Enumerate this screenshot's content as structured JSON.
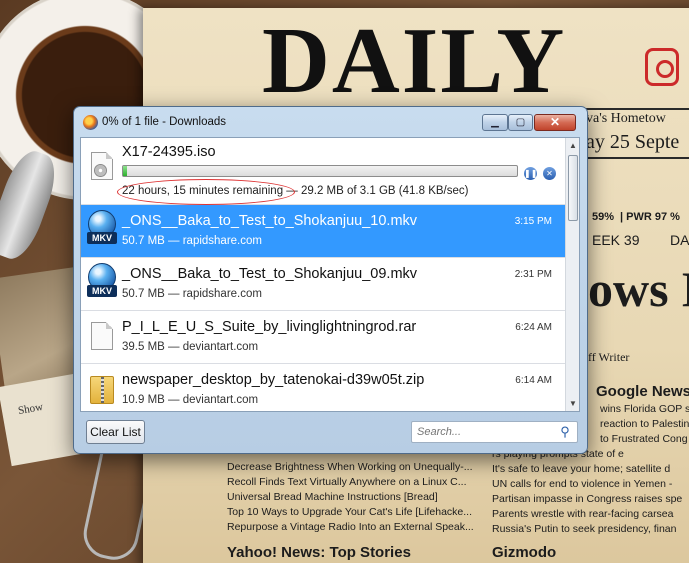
{
  "newspaper": {
    "masthead": "DAILY",
    "weather_frag": "va's Hometow",
    "date_frag": "ay 25 Septe",
    "stats_pct": "59%",
    "stats_pwr": "| PWR 97 %",
    "stats_week": "EEK 39",
    "stats_da": "DA",
    "headline_frag": "ows I",
    "staff_writer": "ff Writer",
    "google_news_title": "Google News",
    "google_news_items": [
      "wins Florida GOP s",
      "reaction to Palestin",
      "to Frustrated Cong",
      "rs playing prompts state of e",
      "It's safe to leave your home; satellite d",
      "UN calls for end to violence in Yemen -",
      "Partisan impasse in Congress raises spe",
      "Parents wrestle with rear-facing carsea",
      "Russia's Putin to seek presidency, finan"
    ],
    "lifehacker_items": [
      "Decrease Brightness When Working on Unequally-...",
      "Recoll Finds Text Virtually Anywhere on a Linux C...",
      "Universal Bread Machine Instructions [Bread]",
      "Top 10 Ways to Upgrade Your Cat's Life [Lifehacke...",
      "Repurpose a Vintage Radio Into an External Speak..."
    ],
    "yahoo_title": "Yahoo! News: Top Stories",
    "gizmodo_title": "Gizmodo",
    "photo_label": "Show"
  },
  "window": {
    "title": "0% of 1 file - Downloads",
    "min_label": "▁",
    "max_label": "▢",
    "close_label": "✕"
  },
  "active_download": {
    "filename": "X17-24395.iso",
    "progress_fraction": 0.01,
    "time_remaining": "22 hours, 15 minutes remaining",
    "transfer": " — 29.2 MB of 3.1 GB (41.8 KB/sec)",
    "pause_icon": "pause-icon",
    "cancel_icon": "cancel-icon",
    "file_icon": "disc-image-icon"
  },
  "downloads": [
    {
      "name": "_ONS__Baka_to_Test_to_Shokanjuu_10.mkv",
      "meta": "50.7 MB — rapidshare.com",
      "time": "3:15 PM",
      "icon": "mkv-icon",
      "selected": true
    },
    {
      "name": "_ONS__Baka_to_Test_to_Shokanjuu_09.mkv",
      "meta": "50.7 MB — rapidshare.com",
      "time": "2:31 PM",
      "icon": "mkv-icon",
      "selected": false
    },
    {
      "name": "P_I_L_E_U_S_Suite_by_livinglightningrod.rar",
      "meta": "39.5 MB — deviantart.com",
      "time": "6:24 AM",
      "icon": "document-icon",
      "selected": false
    },
    {
      "name": "newspaper_desktop_by_tatenokai-d39w05t.zip",
      "meta": "10.9 MB — deviantart.com",
      "time": "6:14 AM",
      "icon": "zip-folder-icon",
      "selected": false
    }
  ],
  "footer": {
    "clear_list_label": "Clear List",
    "search_placeholder": "Search..."
  },
  "colors": {
    "selection": "#3399ff",
    "progress": "#2fb12f",
    "annotation_oval": "#dd3333"
  }
}
